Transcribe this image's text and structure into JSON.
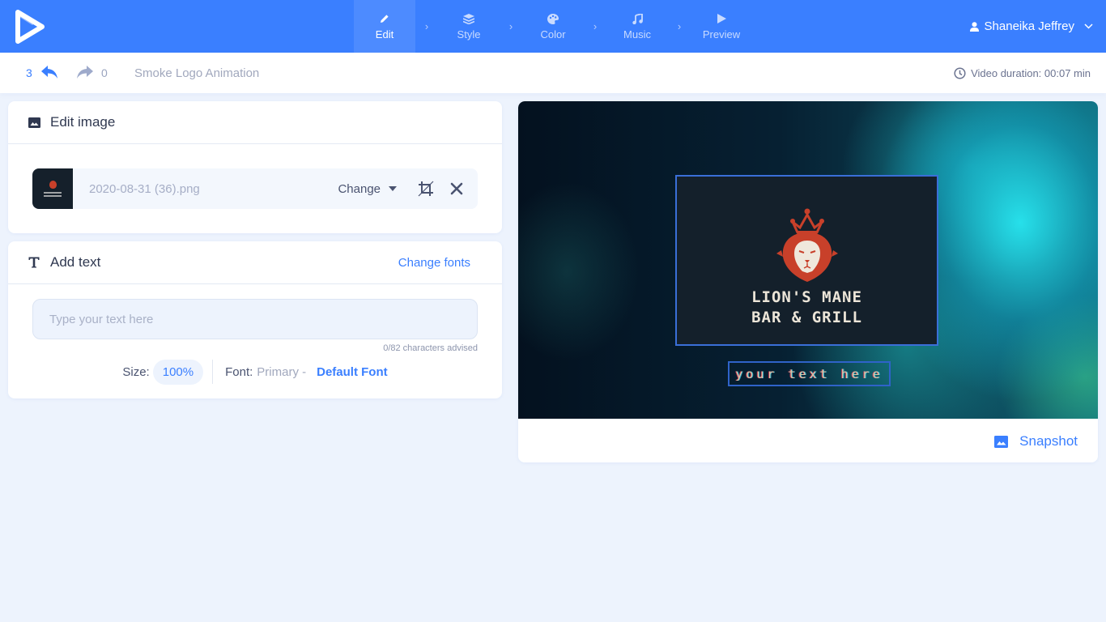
{
  "app": {
    "logo_icon": "play-triangle-logo"
  },
  "nav": {
    "steps": [
      {
        "label": "Edit",
        "icon": "pencil-icon",
        "active": true
      },
      {
        "label": "Style",
        "icon": "layers-icon",
        "active": false
      },
      {
        "label": "Color",
        "icon": "palette-icon",
        "active": false
      },
      {
        "label": "Music",
        "icon": "music-note-icon",
        "active": false
      },
      {
        "label": "Preview",
        "icon": "play-icon",
        "active": false
      }
    ],
    "separator": "›",
    "user": {
      "name": "Shaneika Jeffrey",
      "icon": "user-icon"
    }
  },
  "subbar": {
    "undo_count": "3",
    "redo_count": "0",
    "project_title": "Smoke Logo Animation",
    "duration_label": "Video duration: 00:07 min"
  },
  "edit_image": {
    "title": "Edit image",
    "file_name": "2020-08-31 (36).png",
    "change_label": "Change"
  },
  "add_text": {
    "title": "Add text",
    "change_fonts_label": "Change fonts",
    "input_value": "",
    "input_placeholder": "Type your text here",
    "char_hint": "0/82 characters advised",
    "size_label": "Size:",
    "size_value": "100%",
    "font_label": "Font:",
    "font_primary": "Primary -",
    "font_name": "Default Font"
  },
  "preview": {
    "logo_line_1": "LION'S MANE",
    "logo_line_2": "BAR & GRILL",
    "text_placeholder": "your text here",
    "snapshot_label": "Snapshot"
  },
  "colors": {
    "accent": "#3a7fff",
    "topbar": "#3a7fff",
    "page_bg": "#edf3fd",
    "logo_red": "#c8402a",
    "logo_bg": "#14202b"
  }
}
